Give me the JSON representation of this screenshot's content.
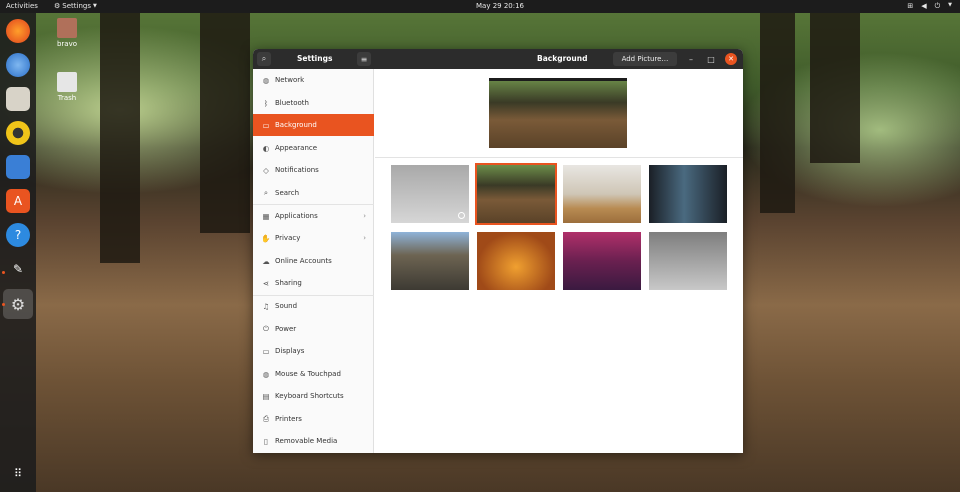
{
  "topbar": {
    "activities": "Activities",
    "app_menu": "Settings",
    "clock": "May 29  20:16",
    "tray_icons": [
      "network-icon",
      "volume-icon",
      "power-icon"
    ]
  },
  "dock": {
    "items": [
      "firefox-icon",
      "thunderbird-icon",
      "files-icon",
      "rhythmbox-icon",
      "writer-icon",
      "software-icon",
      "help-icon",
      "tools-icon",
      "settings-icon"
    ],
    "apps_grid": "apps-grid-icon"
  },
  "desktop": {
    "icons": [
      {
        "label": "bravo",
        "icon": "home-folder-icon"
      },
      {
        "label": "Trash",
        "icon": "trash-icon"
      }
    ]
  },
  "window": {
    "sidebar_title": "Settings",
    "page_title": "Background",
    "add_picture": "Add Picture…",
    "controls": {
      "minimize": "–",
      "maximize": "□",
      "close": "✕"
    }
  },
  "sidebar": {
    "items": [
      {
        "label": "Network",
        "icon": "network-icon"
      },
      {
        "label": "Bluetooth",
        "icon": "bluetooth-icon"
      },
      {
        "label": "Background",
        "icon": "background-icon",
        "selected": true
      },
      {
        "label": "Appearance",
        "icon": "appearance-icon"
      },
      {
        "label": "Notifications",
        "icon": "bell-icon"
      },
      {
        "label": "Search",
        "icon": "search-icon"
      },
      {
        "label": "Applications",
        "icon": "applications-icon",
        "submenu": true
      },
      {
        "label": "Privacy",
        "icon": "privacy-icon",
        "submenu": true
      },
      {
        "label": "Online Accounts",
        "icon": "cloud-icon"
      },
      {
        "label": "Sharing",
        "icon": "share-icon"
      },
      {
        "label": "Sound",
        "icon": "music-note-icon"
      },
      {
        "label": "Power",
        "icon": "power-icon"
      },
      {
        "label": "Displays",
        "icon": "display-icon"
      },
      {
        "label": "Mouse & Touchpad",
        "icon": "mouse-icon"
      },
      {
        "label": "Keyboard Shortcuts",
        "icon": "keyboard-icon"
      },
      {
        "label": "Printers",
        "icon": "printer-icon"
      },
      {
        "label": "Removable Media",
        "icon": "removable-media-icon"
      }
    ]
  },
  "wallpapers": [
    {
      "name": "gray-gradient",
      "current": false
    },
    {
      "name": "forest-path",
      "current": true
    },
    {
      "name": "table-yellow-object",
      "current": false
    },
    {
      "name": "dark-corridor",
      "current": false
    },
    {
      "name": "bridge",
      "current": false
    },
    {
      "name": "orange-saxophone",
      "current": false
    },
    {
      "name": "purple-gradient",
      "current": false
    },
    {
      "name": "gray-fog",
      "current": false
    }
  ],
  "colors": {
    "accent": "#e95420",
    "headerbar": "#2c2c2c",
    "topbar": "#1c1c1c"
  }
}
